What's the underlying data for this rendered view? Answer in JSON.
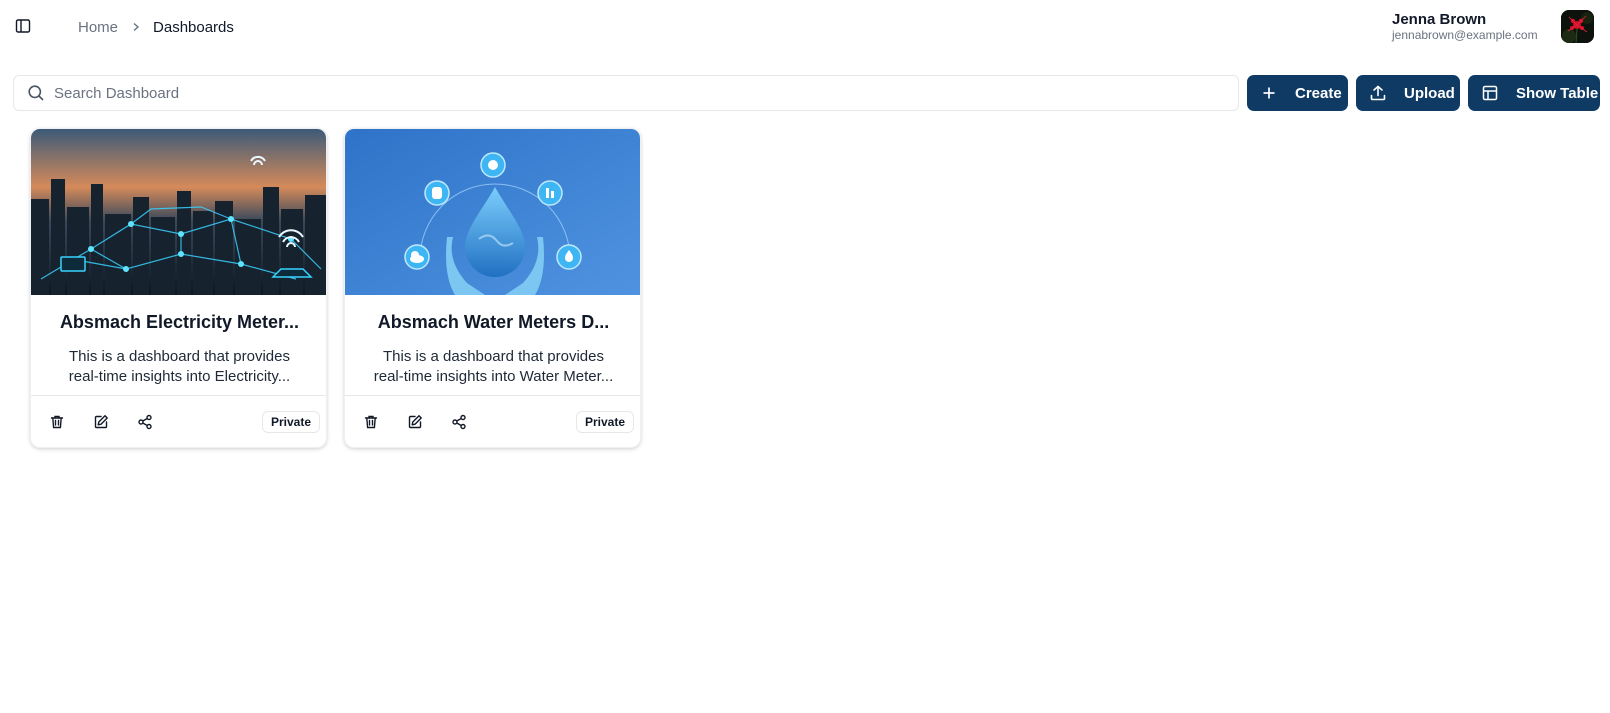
{
  "header": {
    "breadcrumb": {
      "home": "Home",
      "current": "Dashboards"
    },
    "user": {
      "name": "Jenna Brown",
      "email": "jennabrown@example.com"
    }
  },
  "toolbar": {
    "search_placeholder": "Search Dashboard",
    "create_label": "Create",
    "upload_label": "Upload",
    "show_table_label": "Show Table"
  },
  "cards": [
    {
      "title": "Absmach Electricity Meter...",
      "description": "This is a dashboard that provides real-time insights into Electricity...",
      "badge": "Private",
      "image": "smart-city-network"
    },
    {
      "title": "Absmach Water Meters D...",
      "description": "This is a dashboard that provides real-time insights into Water Meter...",
      "badge": "Private",
      "image": "water-drop-hands"
    }
  ],
  "colors": {
    "primary": "#0e3a63",
    "border": "#e5e7eb",
    "muted_text": "#6b7280"
  }
}
